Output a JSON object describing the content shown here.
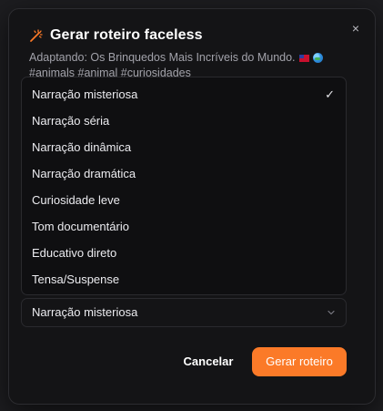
{
  "dialog": {
    "title": "Gerar roteiro faceless",
    "subtitle_line1": "Adaptando: Os Brinquedos Mais Incríveis do Mundo.",
    "subtitle_line2": "#animals #animal #curiosidades",
    "close_label": "×",
    "accent_color": "#fb7a28",
    "icons": [
      "magic-wand-icon",
      "us-flag-icon",
      "globe-icon",
      "check-icon",
      "chevron-down-icon",
      "close-icon"
    ]
  },
  "tone_select": {
    "selected": "Narração misteriosa",
    "options": [
      "Narração misteriosa",
      "Narração séria",
      "Narração dinâmica",
      "Narração dramática",
      "Curiosidade leve",
      "Tom documentário",
      "Educativo direto",
      "Tensa/Suspense"
    ],
    "check_glyph": "✓"
  },
  "actions": {
    "cancel_label": "Cancelar",
    "submit_label": "Gerar roteiro"
  }
}
